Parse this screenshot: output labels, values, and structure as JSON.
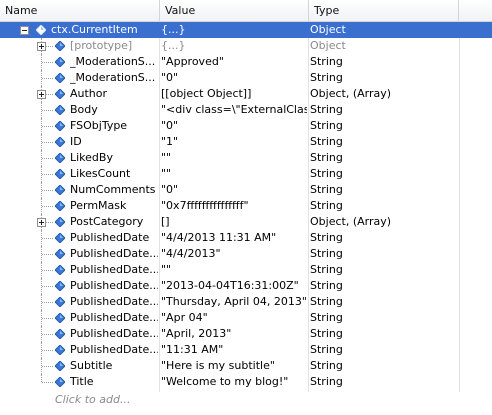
{
  "columns": {
    "name": "Name",
    "value": "Value",
    "type": "Type"
  },
  "rows": [
    {
      "name": "ctx.CurrentItem",
      "value": "{...}",
      "type": "Object",
      "level": 0,
      "expander": "minus",
      "selected": true
    },
    {
      "name": "[prototype]",
      "value": "{...}",
      "type": "Object",
      "level": 1,
      "expander": "plus",
      "proto": true
    },
    {
      "name": "_ModerationS...",
      "value": "\"Approved\"",
      "type": "String",
      "level": 1
    },
    {
      "name": "_ModerationS...",
      "value": "\"0\"",
      "type": "String",
      "level": 1
    },
    {
      "name": "Author",
      "value": "[[object Object]]",
      "type": "Object, (Array)",
      "level": 1,
      "expander": "plus"
    },
    {
      "name": "Body",
      "value": "\"<div class=\\\"ExternalClass...",
      "type": "String",
      "level": 1
    },
    {
      "name": "FSObjType",
      "value": "\"0\"",
      "type": "String",
      "level": 1
    },
    {
      "name": "ID",
      "value": "\"1\"",
      "type": "String",
      "level": 1
    },
    {
      "name": "LikedBy",
      "value": "\"\"",
      "type": "String",
      "level": 1
    },
    {
      "name": "LikesCount",
      "value": "\"\"",
      "type": "String",
      "level": 1
    },
    {
      "name": "NumComments",
      "value": "\"0\"",
      "type": "String",
      "level": 1
    },
    {
      "name": "PermMask",
      "value": "\"0x7fffffffffffffff\"",
      "type": "String",
      "level": 1
    },
    {
      "name": "PostCategory",
      "value": "[]",
      "type": "Object, (Array)",
      "level": 1,
      "expander": "plus"
    },
    {
      "name": "PublishedDate",
      "value": "\"4/4/2013 11:31 AM\"",
      "type": "String",
      "level": 1
    },
    {
      "name": "PublishedDate...",
      "value": "\"4/4/2013\"",
      "type": "String",
      "level": 1
    },
    {
      "name": "PublishedDate...",
      "value": "\"\"",
      "type": "String",
      "level": 1
    },
    {
      "name": "PublishedDate...",
      "value": "\"2013-04-04T16:31:00Z\"",
      "type": "String",
      "level": 1
    },
    {
      "name": "PublishedDate...",
      "value": "\"Thursday, April 04, 2013\"",
      "type": "String",
      "level": 1
    },
    {
      "name": "PublishedDate...",
      "value": "\"Apr 04\"",
      "type": "String",
      "level": 1
    },
    {
      "name": "PublishedDate...",
      "value": "\"April, 2013\"",
      "type": "String",
      "level": 1
    },
    {
      "name": "PublishedDate...",
      "value": "\"11:31 AM\"",
      "type": "String",
      "level": 1
    },
    {
      "name": "Subtitle",
      "value": "\"Here is my subtitle\"",
      "type": "String",
      "level": 1
    },
    {
      "name": "Title",
      "value": "\"Welcome to my blog!\"",
      "type": "String",
      "level": 1
    }
  ],
  "add_placeholder": "Click to add...",
  "icon": "property-diamond-icon",
  "colors": {
    "selection": "#3a6fd0",
    "icon_blue": "#3b78d8",
    "grid_line": "#e2e2e2"
  }
}
